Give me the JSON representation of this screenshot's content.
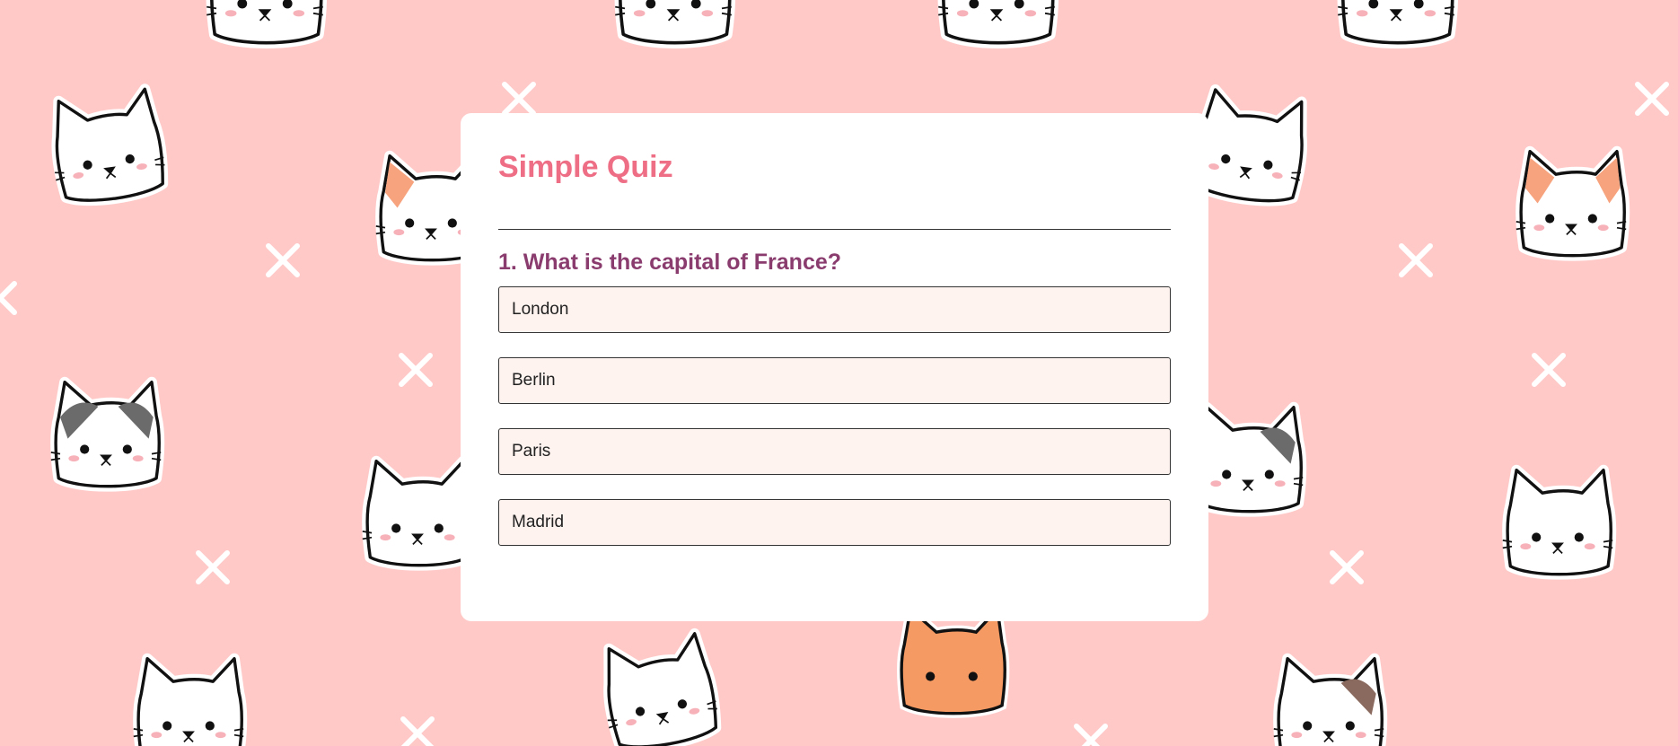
{
  "quiz": {
    "title": "Simple Quiz",
    "question": "1. What is the capital of France?",
    "options": [
      "London",
      "Berlin",
      "Paris",
      "Madrid"
    ]
  },
  "colors": {
    "background": "#ffc9c8",
    "card": "#ffffff",
    "title": "#ee6e86",
    "question": "#8a3c6e",
    "option_background": "#fff3ef"
  },
  "background_pattern": {
    "icons": [
      "cat-face-icon",
      "cross-icon"
    ]
  }
}
